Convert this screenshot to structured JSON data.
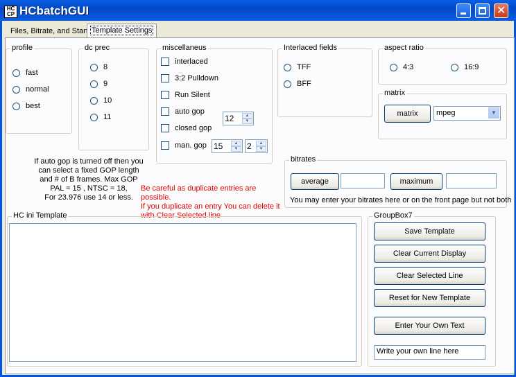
{
  "window": {
    "title": "HCbatchGUI",
    "icon_text": "HC\nCP"
  },
  "tabs": [
    {
      "label": "Files, Bitrate, and Start"
    },
    {
      "label": "Template Settings"
    }
  ],
  "profile": {
    "legend": "profile",
    "options": [
      "fast",
      "normal",
      "best"
    ]
  },
  "dcprec": {
    "legend": "dc prec",
    "options": [
      "8",
      "9",
      "10",
      "11"
    ]
  },
  "misc": {
    "legend": "miscellaneus",
    "checks": [
      "interlaced",
      "3:2 Pulldown",
      "Run Silent",
      "auto gop",
      "closed gop",
      "man. gop"
    ],
    "autogop_value": "12",
    "mangop_value1": "15",
    "mangop_value2": "2"
  },
  "interlaced": {
    "legend": "Interlaced fields",
    "options": [
      "TFF",
      "BFF"
    ]
  },
  "aspect": {
    "legend": "aspect ratio",
    "options": [
      "4:3",
      "16:9"
    ]
  },
  "matrix": {
    "legend": "matrix",
    "button": "matrix",
    "select_value": "mpeg"
  },
  "bitrates": {
    "legend": "bitrates",
    "average": "average",
    "maximum": "maximum",
    "note": "You may enter your bitrates here or on the front page but not both",
    "average_value": "",
    "maximum_value": ""
  },
  "gop_note": [
    "If auto gop is turned off then you",
    "can select a fixed GOP length",
    "and # of B frames.  Max GOP",
    "PAL = 15 , NTSC = 18,",
    "For 23.976 use 14 or less."
  ],
  "warning": [
    "Be careful as duplicate entries are possible.",
    "If you duplicate an entry You can delete it",
    "with Clear Selected line"
  ],
  "template": {
    "legend": "HC ini Template"
  },
  "groupbox7": {
    "legend": "GroupBox7",
    "save": "Save Template",
    "clear_display": "Clear Current Display",
    "clear_line": "Clear Selected Line",
    "reset": "Reset for New Template",
    "enter_text": "Enter Your Own Text",
    "own_line_value": "Write your own line here"
  }
}
